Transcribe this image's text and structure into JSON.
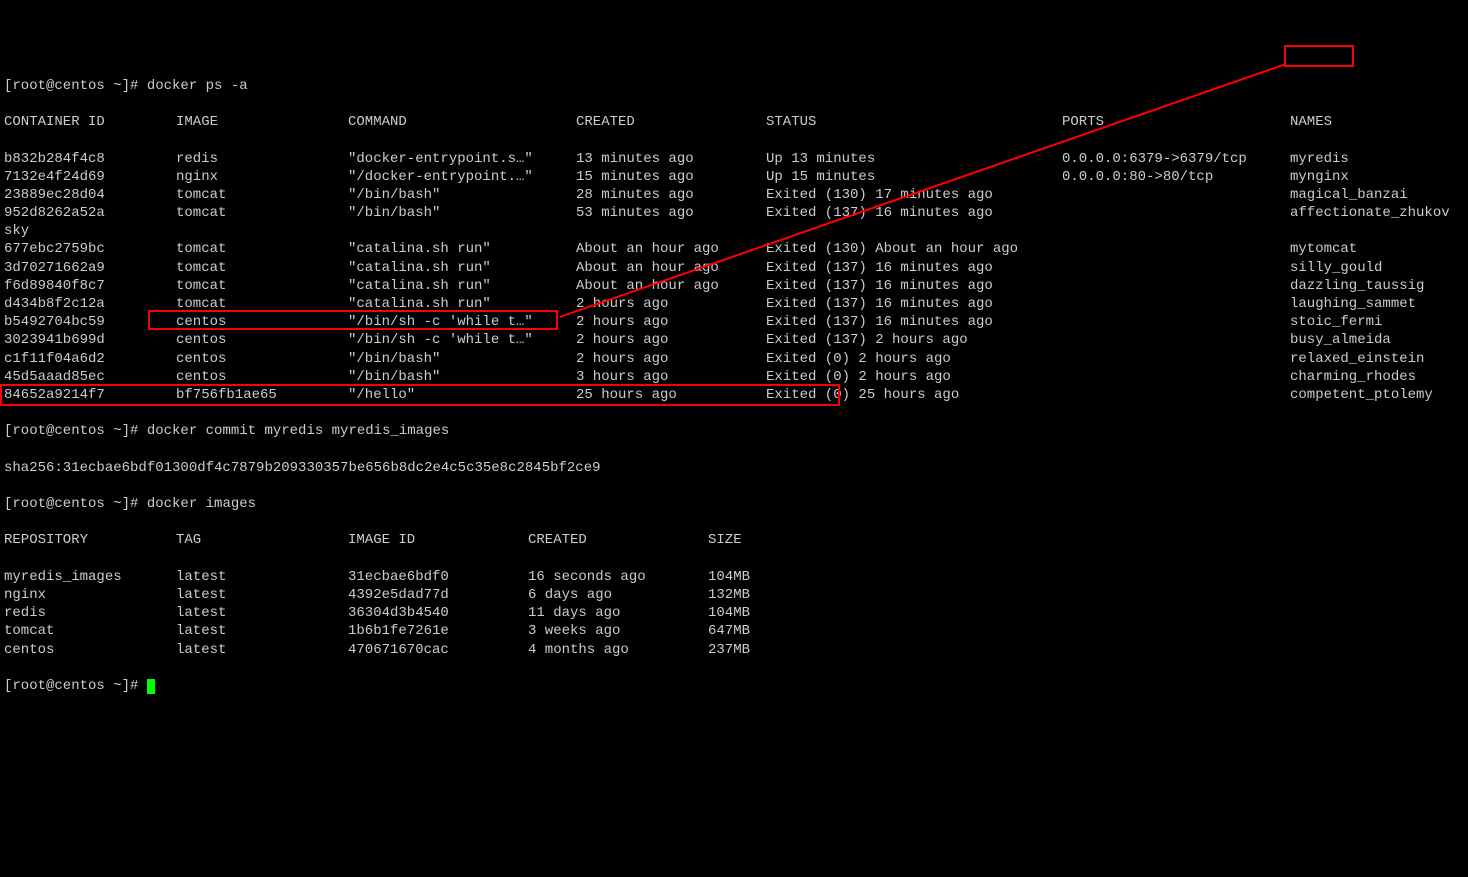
{
  "prompt": "[root@centos ~]# ",
  "cmd1": "docker ps -a",
  "ps_headers": {
    "id": "CONTAINER ID",
    "image": "IMAGE",
    "command": "COMMAND",
    "created": "CREATED",
    "status": "STATUS",
    "ports": "PORTS",
    "names": "NAMES"
  },
  "containers": [
    {
      "id": "b832b284f4c8",
      "image": "redis",
      "command": "\"docker-entrypoint.s…\"",
      "created": "13 minutes ago",
      "status": "Up 13 minutes",
      "ports": "0.0.0.0:6379->6379/tcp",
      "name": "myredis"
    },
    {
      "id": "7132e4f24d69",
      "image": "nginx",
      "command": "\"/docker-entrypoint.…\"",
      "created": "15 minutes ago",
      "status": "Up 15 minutes",
      "ports": "0.0.0.0:80->80/tcp",
      "name": "mynginx"
    },
    {
      "id": "23889ec28d04",
      "image": "tomcat",
      "command": "\"/bin/bash\"",
      "created": "28 minutes ago",
      "status": "Exited (130) 17 minutes ago",
      "ports": "",
      "name": "magical_banzai"
    },
    {
      "id": "952d8262a52a",
      "image": "tomcat",
      "command": "\"/bin/bash\"",
      "created": "53 minutes ago",
      "status": "Exited (137) 16 minutes ago",
      "ports": "",
      "name": "affectionate_zhukovsky"
    },
    {
      "id": "677ebc2759bc",
      "image": "tomcat",
      "command": "\"catalina.sh run\"",
      "created": "About an hour ago",
      "status": "Exited (130) About an hour ago",
      "ports": "",
      "name": "mytomcat"
    },
    {
      "id": "3d70271662a9",
      "image": "tomcat",
      "command": "\"catalina.sh run\"",
      "created": "About an hour ago",
      "status": "Exited (137) 16 minutes ago",
      "ports": "",
      "name": "silly_gould"
    },
    {
      "id": "f6d89840f8c7",
      "image": "tomcat",
      "command": "\"catalina.sh run\"",
      "created": "About an hour ago",
      "status": "Exited (137) 16 minutes ago",
      "ports": "",
      "name": "dazzling_taussig"
    },
    {
      "id": "d434b8f2c12a",
      "image": "tomcat",
      "command": "\"catalina.sh run\"",
      "created": "2 hours ago",
      "status": "Exited (137) 16 minutes ago",
      "ports": "",
      "name": "laughing_sammet"
    },
    {
      "id": "b5492704bc59",
      "image": "centos",
      "command": "\"/bin/sh -c 'while t…\"",
      "created": "2 hours ago",
      "status": "Exited (137) 16 minutes ago",
      "ports": "",
      "name": "stoic_fermi"
    },
    {
      "id": "3023941b699d",
      "image": "centos",
      "command": "\"/bin/sh -c 'while t…\"",
      "created": "2 hours ago",
      "status": "Exited (137) 2 hours ago",
      "ports": "",
      "name": "busy_almeida"
    },
    {
      "id": "c1f11f04a6d2",
      "image": "centos",
      "command": "\"/bin/bash\"",
      "created": "2 hours ago",
      "status": "Exited (0) 2 hours ago",
      "ports": "",
      "name": "relaxed_einstein"
    },
    {
      "id": "45d5aaad85ec",
      "image": "centos",
      "command": "\"/bin/bash\"",
      "created": "3 hours ago",
      "status": "Exited (0) 2 hours ago",
      "ports": "",
      "name": "charming_rhodes"
    },
    {
      "id": "84652a9214f7",
      "image": "bf756fb1ae65",
      "command": "\"/hello\"",
      "created": "25 hours ago",
      "status": "Exited (0) 25 hours ago",
      "ports": "",
      "name": "competent_ptolemy"
    }
  ],
  "cmd2": "docker commit myredis myredis_images",
  "commit_output": "sha256:31ecbae6bdf01300df4c7879b209330357be656b8dc2e4c5c35e8c2845bf2ce9",
  "cmd3": "docker images",
  "img_headers": {
    "repo": "REPOSITORY",
    "tag": "TAG",
    "id": "IMAGE ID",
    "created": "CREATED",
    "size": "SIZE"
  },
  "images": [
    {
      "repo": "myredis_images",
      "tag": "latest",
      "id": "31ecbae6bdf0",
      "created": "16 seconds ago",
      "size": "104MB"
    },
    {
      "repo": "nginx",
      "tag": "latest",
      "id": "4392e5dad77d",
      "created": "6 days ago",
      "size": "132MB"
    },
    {
      "repo": "redis",
      "tag": "latest",
      "id": "36304d3b4540",
      "created": "11 days ago",
      "size": "104MB"
    },
    {
      "repo": "tomcat",
      "tag": "latest",
      "id": "1b6b1fe7261e",
      "created": "3 weeks ago",
      "size": "647MB"
    },
    {
      "repo": "centos",
      "tag": "latest",
      "id": "470671670cac",
      "created": "4 months ago",
      "size": "237MB"
    }
  ]
}
